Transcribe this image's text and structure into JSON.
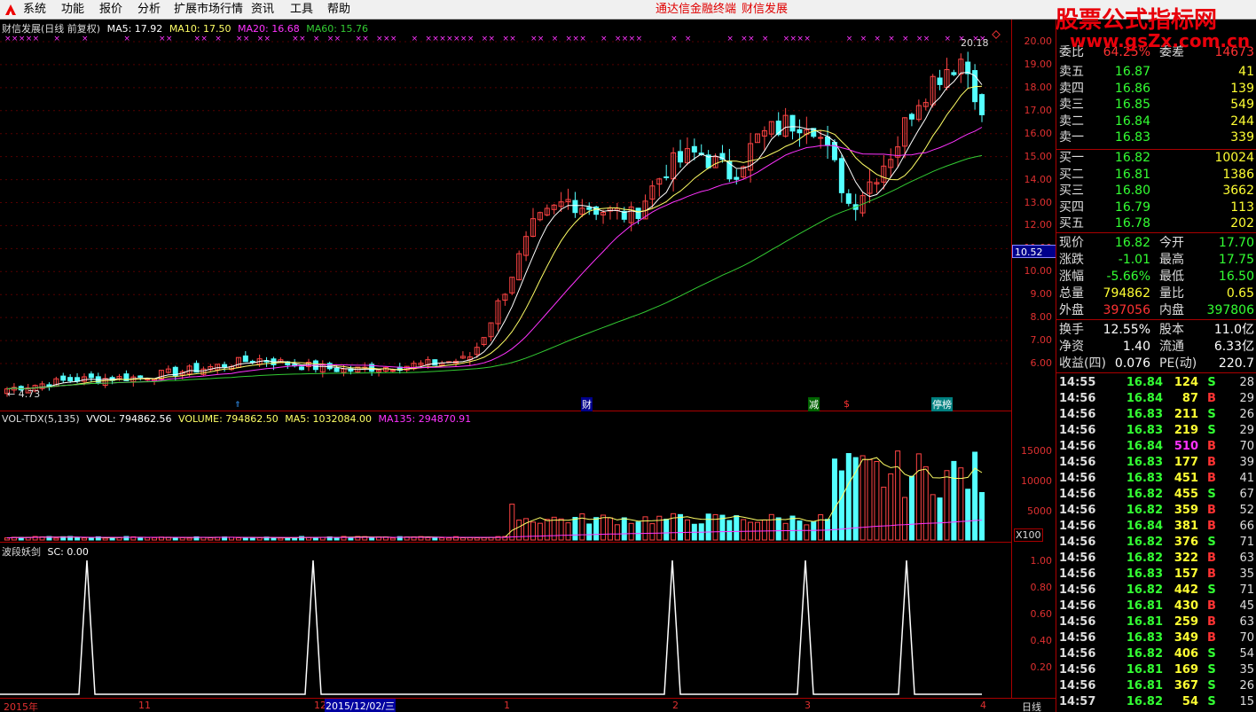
{
  "menu": {
    "items": [
      "系统",
      "功能",
      "报价",
      "分析",
      "扩展市场行情",
      "资讯",
      "工具",
      "帮助"
    ],
    "center_titles": [
      "通达信金融终端",
      "财信发展"
    ]
  },
  "watermark": {
    "cn": "股票公式指标网",
    "url": "www.gsZx.com.cn"
  },
  "main": {
    "legend": {
      "title": "财信发展(日线 前复权)",
      "ma5": "MA5: 17.92",
      "ma10": "MA10: 17.50",
      "ma20": "MA20: 16.68",
      "ma60": "MA60: 15.76"
    },
    "high_label": "20.18",
    "low_label": "4.73",
    "current_price_tag": "10.52",
    "price_ticks": [
      "20.00",
      "19.00",
      "18.00",
      "17.00",
      "16.00",
      "15.00",
      "14.00",
      "13.00",
      "12.00",
      "11.00",
      "10.00",
      "9.00",
      "8.00",
      "7.00",
      "6.00"
    ],
    "markers": [
      "财",
      "减",
      "$",
      "停榜"
    ]
  },
  "volume": {
    "legend": {
      "title": "VOL-TDX(5,135)",
      "vvol": "VVOL: 794862.56",
      "volume": "VOLUME: 794862.50",
      "ma5": "MA5: 1032084.00",
      "ma135": "MA135: 294870.91"
    },
    "ticks": [
      "15000",
      "10000",
      "5000"
    ],
    "unit": "X100"
  },
  "indicator": {
    "legend": {
      "title": "波段妖剑",
      "sc": "SC: 0.00"
    },
    "ticks": [
      "1.00",
      "0.80",
      "0.60",
      "0.40",
      "0.20"
    ]
  },
  "dates": {
    "labels": [
      "2015年",
      "11",
      "12",
      "2015/12/02/三",
      "1",
      "2",
      "3",
      "4"
    ],
    "period": "日线"
  },
  "quote": {
    "header": {
      "left_label": "委比",
      "left_value": "64.25%",
      "right_label": "委差",
      "right_value": "14673"
    },
    "asks": [
      {
        "label": "卖五",
        "price": "16.87",
        "qty": "41"
      },
      {
        "label": "卖四",
        "price": "16.86",
        "qty": "139"
      },
      {
        "label": "卖三",
        "price": "16.85",
        "qty": "549"
      },
      {
        "label": "卖二",
        "price": "16.84",
        "qty": "244"
      },
      {
        "label": "卖一",
        "price": "16.83",
        "qty": "339"
      }
    ],
    "bids": [
      {
        "label": "买一",
        "price": "16.82",
        "qty": "10024"
      },
      {
        "label": "买二",
        "price": "16.81",
        "qty": "1386"
      },
      {
        "label": "买三",
        "price": "16.80",
        "qty": "3662"
      },
      {
        "label": "买四",
        "price": "16.79",
        "qty": "113"
      },
      {
        "label": "买五",
        "price": "16.78",
        "qty": "202"
      }
    ],
    "stats1": [
      {
        "l1": "现价",
        "v1": "16.82",
        "c1": "green",
        "l2": "今开",
        "v2": "17.70",
        "c2": "green"
      },
      {
        "l1": "涨跌",
        "v1": "-1.01",
        "c1": "green",
        "l2": "最高",
        "v2": "17.75",
        "c2": "green"
      },
      {
        "l1": "涨幅",
        "v1": "-5.66%",
        "c1": "green",
        "l2": "最低",
        "v2": "16.50",
        "c2": "green"
      },
      {
        "l1": "总量",
        "v1": "794862",
        "c1": "yellow",
        "l2": "量比",
        "v2": "0.65",
        "c2": "yellow"
      },
      {
        "l1": "外盘",
        "v1": "397056",
        "c1": "red",
        "l2": "内盘",
        "v2": "397806",
        "c2": "green"
      }
    ],
    "stats2": [
      {
        "l1": "换手",
        "v1": "12.55%",
        "l2": "股本",
        "v2": "11.0亿"
      },
      {
        "l1": "净资",
        "v1": "1.40",
        "l2": "流通",
        "v2": "6.33亿"
      },
      {
        "l1": "收益(四)",
        "v1": "0.076",
        "l2": "PE(动)",
        "v2": "220.7"
      }
    ],
    "ticks": [
      {
        "time": "14:55",
        "price": "16.84",
        "qty": "124",
        "side": "S",
        "n": "28"
      },
      {
        "time": "14:56",
        "price": "16.84",
        "qty": "87",
        "side": "B",
        "n": "29"
      },
      {
        "time": "14:56",
        "price": "16.83",
        "qty": "211",
        "side": "S",
        "n": "26"
      },
      {
        "time": "14:56",
        "price": "16.83",
        "qty": "219",
        "side": "S",
        "n": "29"
      },
      {
        "time": "14:56",
        "price": "16.84",
        "qty": "510",
        "side": "B",
        "n": "70"
      },
      {
        "time": "14:56",
        "price": "16.83",
        "qty": "177",
        "side": "B",
        "n": "39"
      },
      {
        "time": "14:56",
        "price": "16.83",
        "qty": "451",
        "side": "B",
        "n": "41"
      },
      {
        "time": "14:56",
        "price": "16.82",
        "qty": "455",
        "side": "S",
        "n": "67"
      },
      {
        "time": "14:56",
        "price": "16.82",
        "qty": "359",
        "side": "B",
        "n": "52"
      },
      {
        "time": "14:56",
        "price": "16.84",
        "qty": "381",
        "side": "B",
        "n": "66"
      },
      {
        "time": "14:56",
        "price": "16.82",
        "qty": "376",
        "side": "S",
        "n": "71"
      },
      {
        "time": "14:56",
        "price": "16.82",
        "qty": "322",
        "side": "B",
        "n": "63"
      },
      {
        "time": "14:56",
        "price": "16.83",
        "qty": "157",
        "side": "B",
        "n": "35"
      },
      {
        "time": "14:56",
        "price": "16.82",
        "qty": "442",
        "side": "S",
        "n": "71"
      },
      {
        "time": "14:56",
        "price": "16.81",
        "qty": "430",
        "side": "B",
        "n": "45"
      },
      {
        "time": "14:56",
        "price": "16.81",
        "qty": "259",
        "side": "B",
        "n": "63"
      },
      {
        "time": "14:56",
        "price": "16.83",
        "qty": "349",
        "side": "B",
        "n": "70"
      },
      {
        "time": "14:56",
        "price": "16.82",
        "qty": "406",
        "side": "S",
        "n": "54"
      },
      {
        "time": "14:56",
        "price": "16.81",
        "qty": "169",
        "side": "S",
        "n": "35"
      },
      {
        "time": "14:56",
        "price": "16.81",
        "qty": "367",
        "side": "S",
        "n": "26"
      },
      {
        "time": "14:57",
        "price": "16.82",
        "qty": "54",
        "side": "S",
        "n": "15"
      }
    ]
  },
  "colors": {
    "up": "#ff4444",
    "down": "#54ffff",
    "ma5": "#ffffff",
    "ma10": "#ffff66",
    "ma20": "#ff33ff",
    "ma60": "#33cc33",
    "grid": "#a00000"
  }
}
